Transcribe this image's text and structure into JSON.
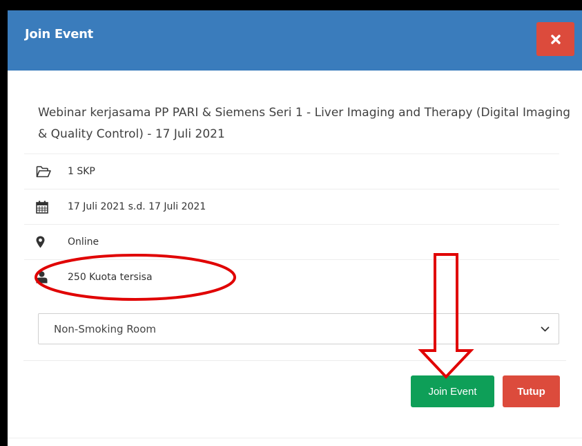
{
  "modal": {
    "title": "Join Event",
    "close_icon": "close-icon"
  },
  "event": {
    "title": "Webinar kerjasama PP PARI & Siemens Seri 1 - Liver Imaging and Therapy (Digital Imaging & Quality Control) - 17 Juli 2021",
    "rows": [
      {
        "icon": "folder-open-icon",
        "text": "1 SKP"
      },
      {
        "icon": "calendar-icon",
        "text": "17 Juli 2021 s.d. 17 Juli 2021"
      },
      {
        "icon": "map-marker-icon",
        "text": "Online"
      },
      {
        "icon": "user-icon",
        "text": "250 Kuota tersisa"
      }
    ]
  },
  "room_select": {
    "value": "Non-Smoking Room"
  },
  "buttons": {
    "join": "Join Event",
    "close": "Tutup"
  },
  "colors": {
    "header": "#3a7cbc",
    "danger": "#dc4b3c",
    "success": "#0e9f58",
    "annotation": "#e00000"
  }
}
